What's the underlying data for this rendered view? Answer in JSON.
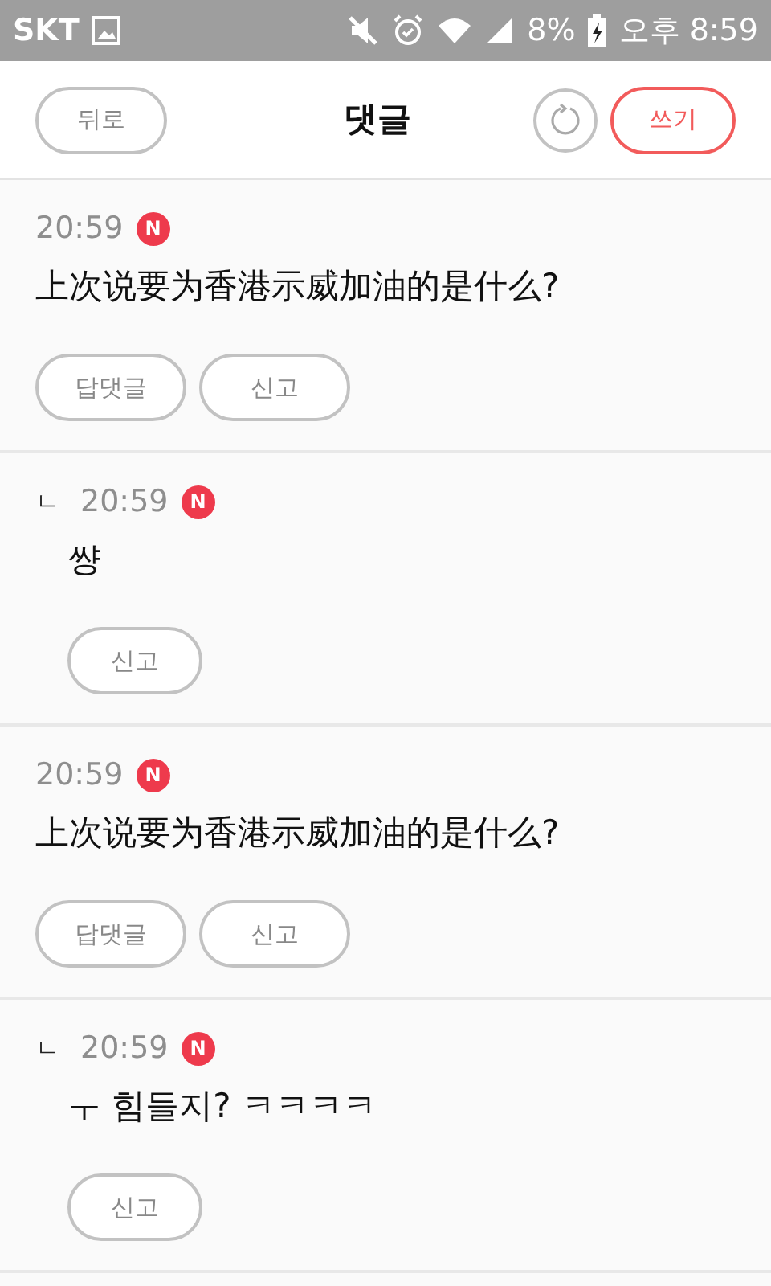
{
  "status_bar": {
    "carrier": "SKT",
    "battery": "8%",
    "time": "오후 8:59"
  },
  "header": {
    "back": "뒤로",
    "title": "댓글",
    "write": "쓰기"
  },
  "comments": [
    {
      "kind": "comment",
      "time": "20:59",
      "badge": "N",
      "text": "上次说要为香港示威加油的是什么?",
      "actions": [
        "답댓글",
        "신고"
      ]
    },
    {
      "kind": "reply",
      "marker": "ㄴ",
      "time": "20:59",
      "badge": "N",
      "text": "썅",
      "actions": [
        "신고"
      ]
    },
    {
      "kind": "comment",
      "time": "20:59",
      "badge": "N",
      "text": "上次说要为香港示威加油的是什么?",
      "actions": [
        "답댓글",
        "신고"
      ]
    },
    {
      "kind": "reply",
      "marker": "ㄴ",
      "time": "20:59",
      "badge": "N",
      "text": "ㅜ 힘들지? ㅋㅋㅋㅋ",
      "actions": [
        "신고"
      ]
    }
  ]
}
